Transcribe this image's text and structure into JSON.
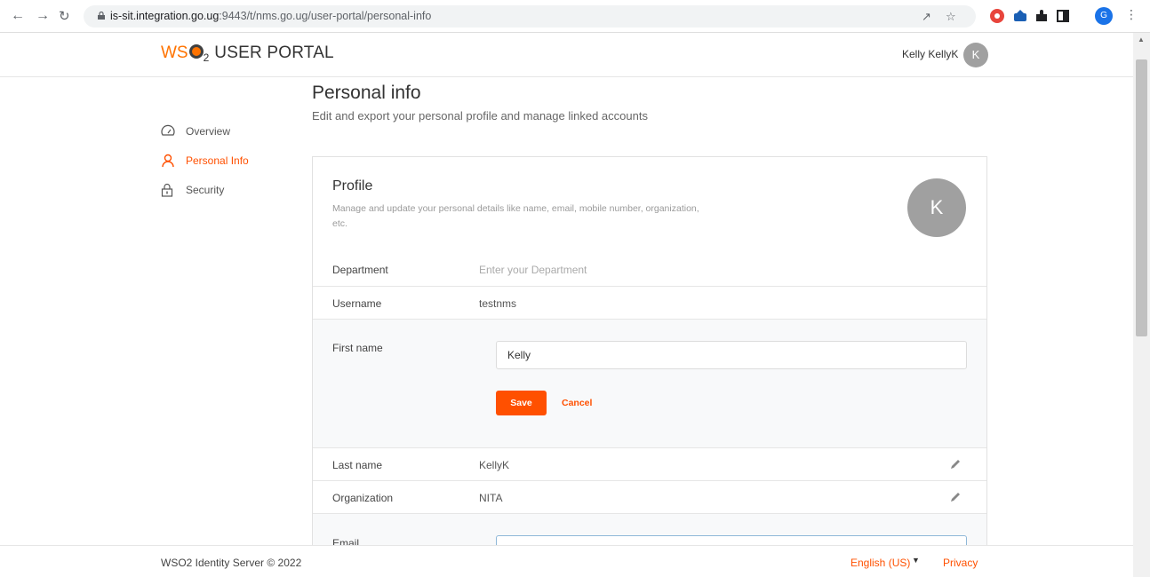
{
  "browser": {
    "url_host": "is-sit.integration.go.ug",
    "url_path": ":9443/t/nms.go.ug/user-portal/personal-info",
    "profile_initial": "G"
  },
  "header": {
    "logo_wso": "WS",
    "logo_sub": "2",
    "logo_product": "USER PORTAL",
    "user_display_name": "Kelly KellyK",
    "user_initial": "K"
  },
  "sidebar": {
    "items": [
      {
        "label": "Overview",
        "icon": "dashboard-icon",
        "active": false
      },
      {
        "label": "Personal Info",
        "icon": "user-icon",
        "active": true
      },
      {
        "label": "Security",
        "icon": "lock-icon",
        "active": false
      }
    ]
  },
  "page": {
    "title": "Personal info",
    "subtitle": "Edit and export your personal profile and manage linked accounts"
  },
  "profile": {
    "title": "Profile",
    "description": "Manage and update your personal details like name, email, mobile number, organization, etc.",
    "avatar_initial": "K",
    "fields": [
      {
        "label": "Department",
        "placeholder": "Enter your Department"
      },
      {
        "label": "Username",
        "value": "testnms"
      },
      {
        "label": "First name",
        "input_value": "Kelly",
        "save_label": "Save",
        "cancel_label": "Cancel"
      },
      {
        "label": "Last name",
        "value": "KellyK"
      },
      {
        "label": "Organization",
        "value": "NITA"
      },
      {
        "label": "Email"
      }
    ]
  },
  "footer": {
    "copyright": "WSO2 Identity Server © 2022",
    "language": "English (US)",
    "privacy": "Privacy"
  },
  "colors": {
    "accent": "#ff5000",
    "brand_orange": "#ff7300",
    "avatar_gray": "#a0a0a0"
  }
}
